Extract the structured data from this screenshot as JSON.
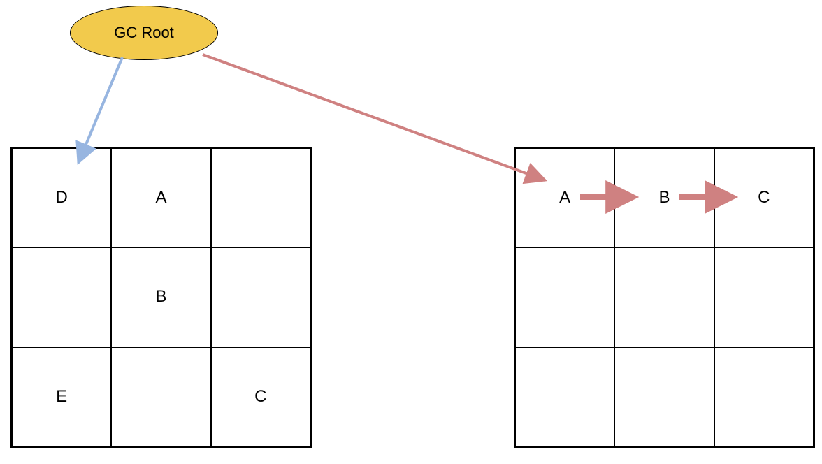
{
  "root": {
    "label": "GC Root"
  },
  "colors": {
    "root_fill": "#f2ca4c",
    "blue": "#97b5e0",
    "red": "#cf8181"
  },
  "left_grid": {
    "cells": [
      {
        "r": 0,
        "c": 0,
        "label": "D"
      },
      {
        "r": 0,
        "c": 1,
        "label": "A"
      },
      {
        "r": 0,
        "c": 2,
        "label": ""
      },
      {
        "r": 1,
        "c": 0,
        "label": ""
      },
      {
        "r": 1,
        "c": 1,
        "label": "B"
      },
      {
        "r": 1,
        "c": 2,
        "label": ""
      },
      {
        "r": 2,
        "c": 0,
        "label": "E"
      },
      {
        "r": 2,
        "c": 1,
        "label": ""
      },
      {
        "r": 2,
        "c": 2,
        "label": "C"
      }
    ]
  },
  "right_grid": {
    "cells": [
      {
        "r": 0,
        "c": 0,
        "label": "A"
      },
      {
        "r": 0,
        "c": 1,
        "label": "B"
      },
      {
        "r": 0,
        "c": 2,
        "label": "C"
      },
      {
        "r": 1,
        "c": 0,
        "label": ""
      },
      {
        "r": 1,
        "c": 1,
        "label": ""
      },
      {
        "r": 1,
        "c": 2,
        "label": ""
      },
      {
        "r": 2,
        "c": 0,
        "label": ""
      },
      {
        "r": 2,
        "c": 1,
        "label": ""
      },
      {
        "r": 2,
        "c": 2,
        "label": ""
      }
    ]
  },
  "arrows": {
    "root_to_left": {
      "from": "gc-root",
      "to": "left-grid-cell-0-0",
      "color": "blue"
    },
    "root_to_right": {
      "from": "gc-root",
      "to": "right-grid-cell-0-0",
      "color": "red"
    },
    "right_chain": [
      {
        "from": "A",
        "to": "B"
      },
      {
        "from": "B",
        "to": "C"
      }
    ]
  }
}
